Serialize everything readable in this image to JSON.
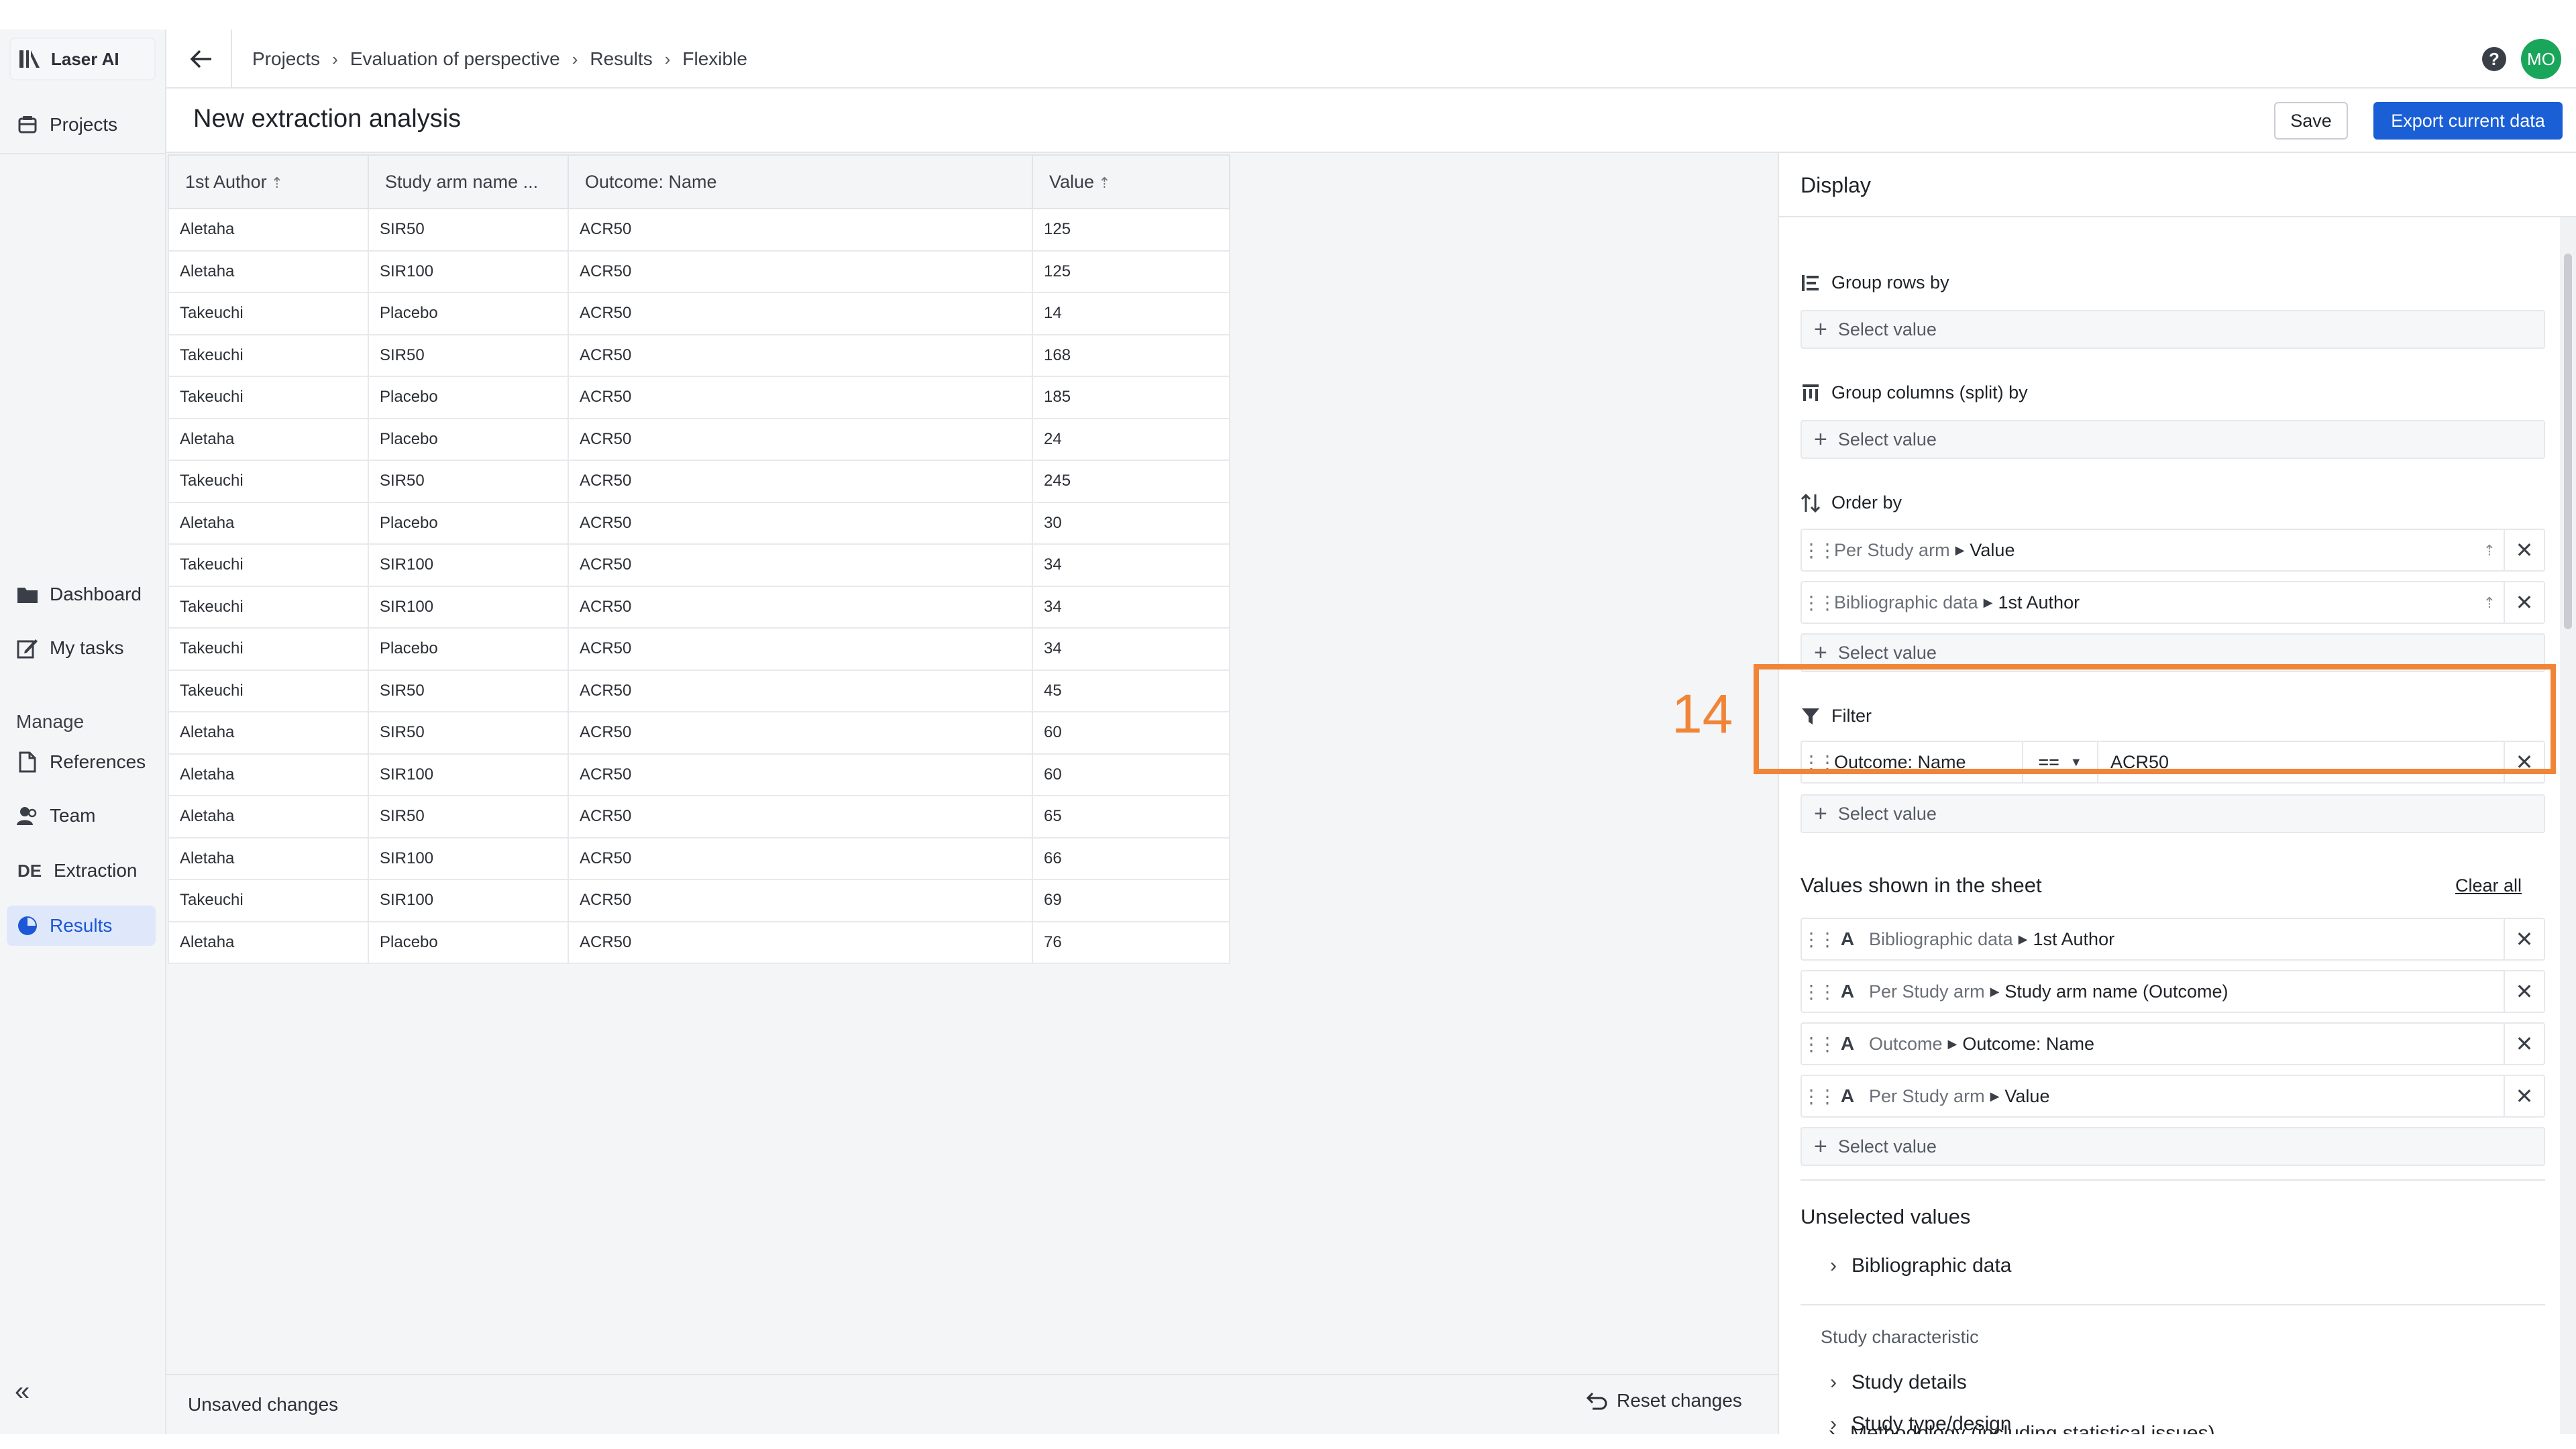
{
  "app": {
    "name": "Laser AI"
  },
  "sidebar": {
    "items": [
      {
        "label": "Projects",
        "icon": "projects-icon"
      },
      {
        "label": "Dashboard",
        "icon": "folder-icon"
      },
      {
        "label": "My tasks",
        "icon": "edit-icon"
      },
      {
        "label": "References",
        "icon": "document-icon"
      },
      {
        "label": "Team",
        "icon": "team-icon"
      },
      {
        "label": "Extraction",
        "icon": "DE"
      },
      {
        "label": "Results",
        "icon": "results-icon"
      }
    ],
    "manage_heading": "Manage",
    "extraction_badge": "DE",
    "collapse_glyph": "«"
  },
  "breadcrumb": [
    "Projects",
    "Evaluation of perspective",
    "Results",
    "Flexible"
  ],
  "user": {
    "initials": "MO"
  },
  "header": {
    "title": "New extraction analysis",
    "save_label": "Save",
    "export_label": "Export current data"
  },
  "table": {
    "columns": [
      "1st Author",
      "Study arm name ...",
      "Outcome: Name",
      "Value"
    ],
    "rows": [
      [
        "Aletaha",
        "SIR50",
        "ACR50",
        "125"
      ],
      [
        "Aletaha",
        "SIR100",
        "ACR50",
        "125"
      ],
      [
        "Takeuchi",
        "Placebo",
        "ACR50",
        "14"
      ],
      [
        "Takeuchi",
        "SIR50",
        "ACR50",
        "168"
      ],
      [
        "Takeuchi",
        "Placebo",
        "ACR50",
        "185"
      ],
      [
        "Aletaha",
        "Placebo",
        "ACR50",
        "24"
      ],
      [
        "Takeuchi",
        "SIR50",
        "ACR50",
        "245"
      ],
      [
        "Aletaha",
        "Placebo",
        "ACR50",
        "30"
      ],
      [
        "Takeuchi",
        "SIR100",
        "ACR50",
        "34"
      ],
      [
        "Takeuchi",
        "SIR100",
        "ACR50",
        "34"
      ],
      [
        "Takeuchi",
        "Placebo",
        "ACR50",
        "34"
      ],
      [
        "Takeuchi",
        "SIR50",
        "ACR50",
        "45"
      ],
      [
        "Aletaha",
        "SIR50",
        "ACR50",
        "60"
      ],
      [
        "Aletaha",
        "SIR100",
        "ACR50",
        "60"
      ],
      [
        "Aletaha",
        "SIR50",
        "ACR50",
        "65"
      ],
      [
        "Aletaha",
        "SIR100",
        "ACR50",
        "66"
      ],
      [
        "Takeuchi",
        "SIR100",
        "ACR50",
        "69"
      ],
      [
        "Aletaha",
        "Placebo",
        "ACR50",
        "76"
      ]
    ]
  },
  "footer": {
    "unsaved": "Unsaved changes",
    "reset": "Reset changes"
  },
  "display": {
    "title": "Display",
    "group_rows_label": "Group rows by",
    "group_cols_label": "Group columns (split) by",
    "order_by_label": "Order by",
    "select_value": "Select value",
    "order_items": [
      {
        "source": "Per Study arm",
        "field": "Value"
      },
      {
        "source": "Bibliographic data",
        "field": "1st Author"
      }
    ],
    "filter": {
      "label": "Filter",
      "field": "Outcome: Name",
      "operator": "==",
      "value": "ACR50"
    },
    "values_shown_label": "Values shown in the sheet",
    "clear_all": "Clear all",
    "values_shown": [
      {
        "source": "Bibliographic data",
        "field": "1st Author"
      },
      {
        "source": "Per Study arm",
        "field": "Study arm name (Outcome)"
      },
      {
        "source": "Outcome",
        "field": "Outcome: Name"
      },
      {
        "source": "Per Study arm",
        "field": "Value"
      }
    ],
    "unselected_label": "Unselected values",
    "unselected_items": [
      "Bibliographic data"
    ],
    "study_characteristic_label": "Study characteristic",
    "study_items": [
      "Study details",
      "Study type/design",
      "Methodology (including statistical issues)"
    ]
  },
  "annotation": {
    "step_number": "14",
    "color": "#f08538"
  },
  "colors": {
    "accent": "#1a5fd6",
    "active_bg": "#dfe8fb",
    "avatar": "#19a55a"
  }
}
